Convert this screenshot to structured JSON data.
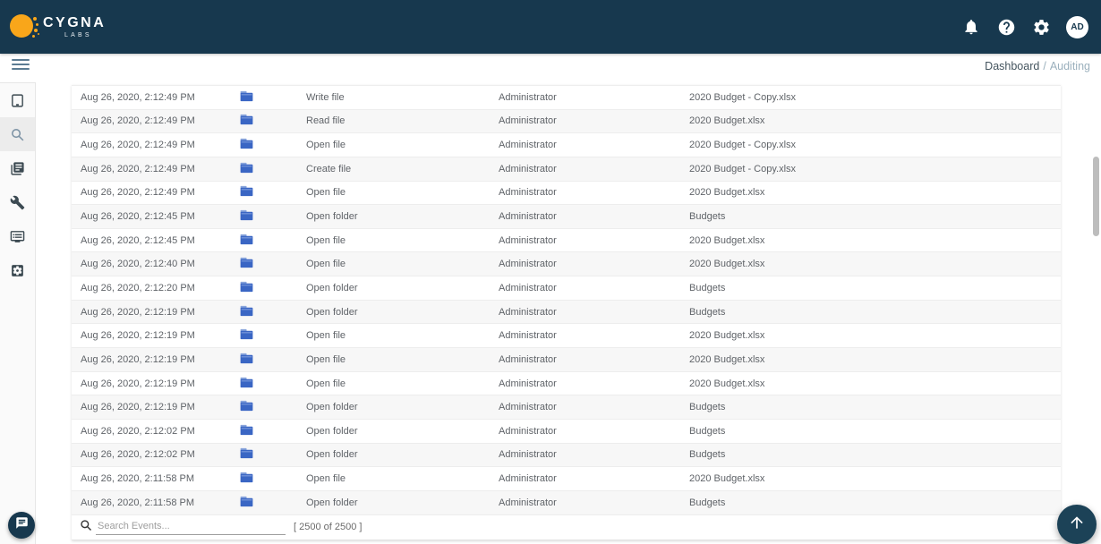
{
  "header": {
    "brand": "CYGNA",
    "brand_sub": "LABS",
    "avatar_initials": "AD",
    "icons": [
      "notifications-icon",
      "help-icon",
      "settings-icon",
      "avatar"
    ]
  },
  "breadcrumb": {
    "parent": "Dashboard",
    "separator": "/",
    "current": "Auditing"
  },
  "sidebar": {
    "menu_icon": "menu-icon",
    "items": [
      {
        "icon": "devices-icon",
        "active": false
      },
      {
        "icon": "search-icon",
        "active": true
      },
      {
        "icon": "reports-icon",
        "active": false
      },
      {
        "icon": "tools-icon",
        "active": false
      },
      {
        "icon": "monitor-icon",
        "active": false
      },
      {
        "icon": "app-settings-icon",
        "active": false
      }
    ]
  },
  "table": {
    "columns": [
      "timestamp",
      "icon",
      "operation",
      "user",
      "target"
    ],
    "row_icon": "folder-icon",
    "rows": [
      {
        "timestamp": "Aug 26, 2020, 2:12:49 PM",
        "operation": "Write file",
        "user": "Administrator",
        "target": "2020 Budget - Copy.xlsx"
      },
      {
        "timestamp": "Aug 26, 2020, 2:12:49 PM",
        "operation": "Read file",
        "user": "Administrator",
        "target": "2020 Budget.xlsx"
      },
      {
        "timestamp": "Aug 26, 2020, 2:12:49 PM",
        "operation": "Open file",
        "user": "Administrator",
        "target": "2020 Budget - Copy.xlsx"
      },
      {
        "timestamp": "Aug 26, 2020, 2:12:49 PM",
        "operation": "Create file",
        "user": "Administrator",
        "target": "2020 Budget - Copy.xlsx"
      },
      {
        "timestamp": "Aug 26, 2020, 2:12:49 PM",
        "operation": "Open file",
        "user": "Administrator",
        "target": "2020 Budget.xlsx"
      },
      {
        "timestamp": "Aug 26, 2020, 2:12:45 PM",
        "operation": "Open folder",
        "user": "Administrator",
        "target": "Budgets"
      },
      {
        "timestamp": "Aug 26, 2020, 2:12:45 PM",
        "operation": "Open file",
        "user": "Administrator",
        "target": "2020 Budget.xlsx"
      },
      {
        "timestamp": "Aug 26, 2020, 2:12:40 PM",
        "operation": "Open file",
        "user": "Administrator",
        "target": "2020 Budget.xlsx"
      },
      {
        "timestamp": "Aug 26, 2020, 2:12:20 PM",
        "operation": "Open folder",
        "user": "Administrator",
        "target": "Budgets"
      },
      {
        "timestamp": "Aug 26, 2020, 2:12:19 PM",
        "operation": "Open folder",
        "user": "Administrator",
        "target": "Budgets"
      },
      {
        "timestamp": "Aug 26, 2020, 2:12:19 PM",
        "operation": "Open file",
        "user": "Administrator",
        "target": "2020 Budget.xlsx"
      },
      {
        "timestamp": "Aug 26, 2020, 2:12:19 PM",
        "operation": "Open file",
        "user": "Administrator",
        "target": "2020 Budget.xlsx"
      },
      {
        "timestamp": "Aug 26, 2020, 2:12:19 PM",
        "operation": "Open file",
        "user": "Administrator",
        "target": "2020 Budget.xlsx"
      },
      {
        "timestamp": "Aug 26, 2020, 2:12:19 PM",
        "operation": "Open folder",
        "user": "Administrator",
        "target": "Budgets"
      },
      {
        "timestamp": "Aug 26, 2020, 2:12:02 PM",
        "operation": "Open folder",
        "user": "Administrator",
        "target": "Budgets"
      },
      {
        "timestamp": "Aug 26, 2020, 2:12:02 PM",
        "operation": "Open folder",
        "user": "Administrator",
        "target": "Budgets"
      },
      {
        "timestamp": "Aug 26, 2020, 2:11:58 PM",
        "operation": "Open file",
        "user": "Administrator",
        "target": "2020 Budget.xlsx"
      },
      {
        "timestamp": "Aug 26, 2020, 2:11:58 PM",
        "operation": "Open folder",
        "user": "Administrator",
        "target": "Budgets"
      }
    ]
  },
  "footer": {
    "search_placeholder": "Search Events...",
    "result_count": "[ 2500 of 2500 ]"
  },
  "fab": {
    "icon": "arrow-up-icon"
  },
  "chat_button": {
    "icon": "chat-icon"
  },
  "colors": {
    "header_bg": "#17384e",
    "brand_orange": "#f9a61a",
    "folder_blue": "#3a66c4",
    "fab_bg": "#1c4257",
    "active_item_bg": "#ececec"
  }
}
